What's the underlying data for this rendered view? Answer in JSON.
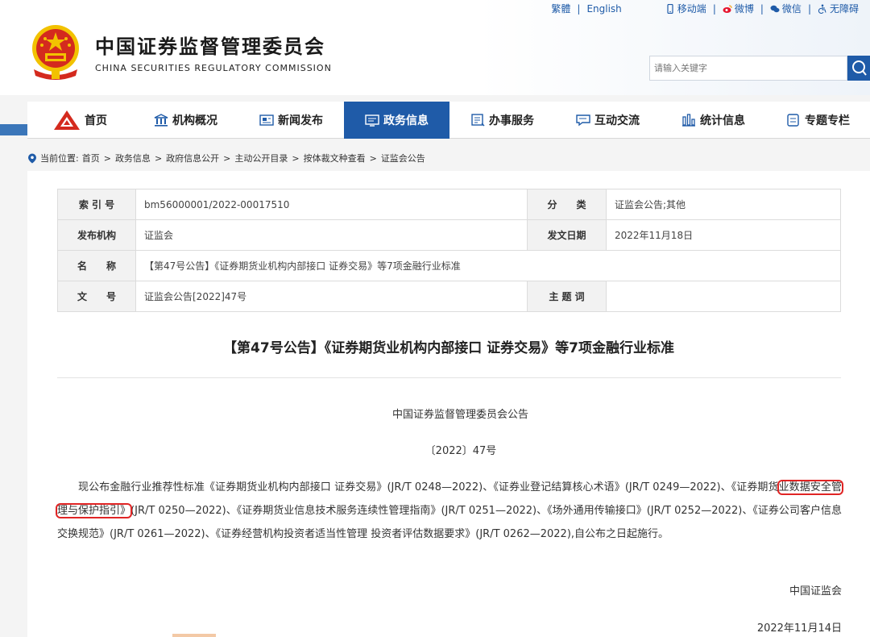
{
  "header": {
    "title": "中国证券监督管理委员会",
    "subtitle": "CHINA SECURITIES REGULATORY COMMISSION",
    "toplinks": {
      "traditional": "繁體",
      "english": "English",
      "mobile": "移动端",
      "weibo": "微博",
      "wechat": "微信",
      "accessibility": "无障碍"
    },
    "search": {
      "placeholder": "请输入关键字",
      "value": ""
    }
  },
  "nav": {
    "items": [
      {
        "label": "首页",
        "icon": "home-logo-icon"
      },
      {
        "label": "机构概况",
        "icon": "building-icon"
      },
      {
        "label": "新闻发布",
        "icon": "news-icon"
      },
      {
        "label": "政务信息",
        "icon": "gov-info-icon",
        "active": true
      },
      {
        "label": "办事服务",
        "icon": "service-icon"
      },
      {
        "label": "互动交流",
        "icon": "chat-icon"
      },
      {
        "label": "统计信息",
        "icon": "bar-chart-icon"
      },
      {
        "label": "专题专栏",
        "icon": "topic-icon"
      }
    ]
  },
  "breadcrumb": {
    "prefix": "当前位置:",
    "items": [
      "首页",
      "政务信息",
      "政府信息公开",
      "主动公开目录",
      "按体裁文种查看",
      "证监会公告"
    ]
  },
  "meta": {
    "index_label": "索 引 号",
    "index_value": "bm56000001/2022-00017510",
    "category_label": "分　　类",
    "category_value": "证监会公告;其他",
    "publisher_label": "发布机构",
    "publisher_value": "证监会",
    "date_label": "发文日期",
    "date_value": "2022年11月18日",
    "name_label": "名　　称",
    "name_value": "【第47号公告】《证券期货业机构内部接口 证券交易》等7项金融行业标准",
    "docno_label": "文　　号",
    "docno_value": "证监会公告[2022]47号",
    "subject_label": "主 题 词",
    "subject_value": ""
  },
  "document": {
    "title": "【第47号公告】《证券期货业机构内部接口 证券交易》等7项金融行业标准",
    "announcer": "中国证券监督管理委员会公告",
    "number": "〔2022〕47号",
    "body_before": "现公布金融行业推荐性标准《证券期货业机构内部接口 证券交易》(JR/T 0248—2022)、《证券业登记结算核心术语》(JR/T 0249—2022)、《证券期货",
    "body_highlight": "业数据安全管理与保护指引》",
    "body_after": "(JR/T 0250—2022)、《证券期货业信息技术服务连续性管理指南》(JR/T 0251—2022)、《场外通用传输接口》(JR/T 0252—2022)、《证券公司客户信息交换规范》(JR/T 0261—2022)、《证券经营机构投资者适当性管理 投资者评估数据要求》(JR/T 0262—2022),自公布之日起施行。",
    "signer": "中国证监会",
    "sign_date": "2022年11月14日"
  },
  "colors": {
    "brand_blue": "#1f5ba8",
    "highlight_red": "#e02424",
    "emblem_red": "#d42a1e",
    "emblem_gold": "#f2c200"
  }
}
